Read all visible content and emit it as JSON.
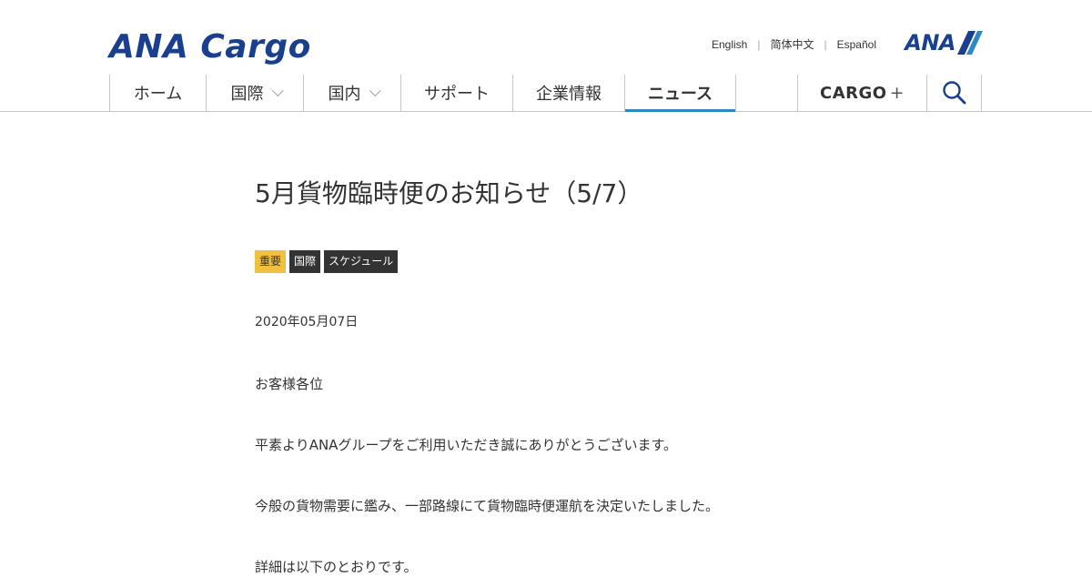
{
  "header": {
    "logo": "ANA Cargo",
    "brand_mark": "ANA",
    "languages": [
      "English",
      "简体中文",
      "Español"
    ]
  },
  "nav": {
    "items": [
      {
        "label": "ホーム",
        "dropdown": false,
        "active": false
      },
      {
        "label": "国際",
        "dropdown": true,
        "active": false
      },
      {
        "label": "国内",
        "dropdown": true,
        "active": false
      },
      {
        "label": "サポート",
        "dropdown": false,
        "active": false
      },
      {
        "label": "企業情報",
        "dropdown": false,
        "active": false
      },
      {
        "label": "ニュース",
        "dropdown": false,
        "active": true
      }
    ],
    "cargo_plus": "CARGO",
    "cargo_plus_symbol": "+",
    "search_icon": "search-icon"
  },
  "article": {
    "title": "5月貨物臨時便のお知らせ（5/7）",
    "tags": [
      "重要",
      "国際",
      "スケジュール"
    ],
    "date": "2020年05月07日",
    "paragraphs": [
      "お客様各位",
      "平素よりANAグループをご利用いただき誠にありがとうございます。",
      "今般の貨物需要に鑑み、一部路線にて貨物臨時便運航を決定いたしました。",
      "詳細は以下のとおりです。"
    ]
  },
  "colors": {
    "brand_blue": "#1a3f8f",
    "brand_light_blue": "#2e88c6",
    "tag_important": "#f0c040",
    "tag_dark": "#333333",
    "divider": "#c8c8c8"
  }
}
